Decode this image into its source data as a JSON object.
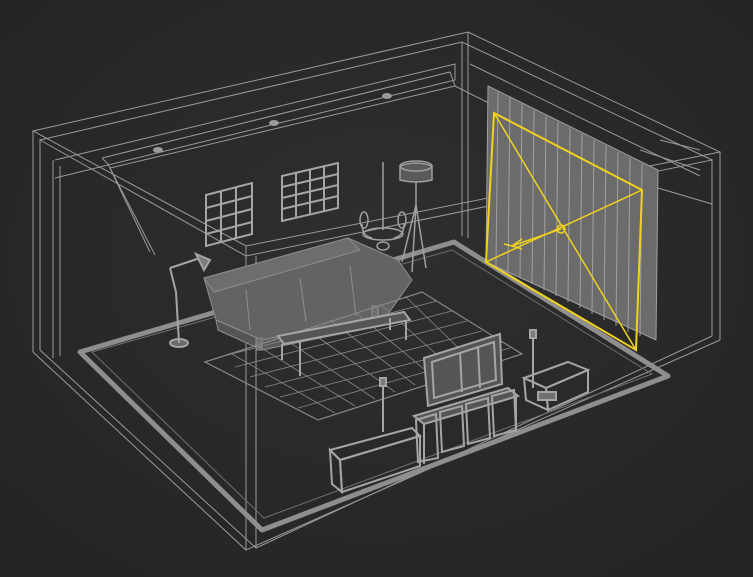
{
  "viewport": {
    "view": "perspective",
    "render_mode": "wireframe",
    "background_color": "#2a2a2a",
    "wire_color": "#8c8c8c",
    "selection_color": "#f0d21e"
  },
  "scene": {
    "objects": [
      "room-shell",
      "ceiling-cove",
      "ceiling-spotlights",
      "window-left",
      "window-right",
      "chandelier",
      "floor-lamp-tripod",
      "floor-lamp-arc",
      "sofa",
      "coffee-table",
      "rug",
      "tv-stand",
      "tv",
      "floor-speakers",
      "side-cabinet",
      "curtain",
      "target-light"
    ],
    "selected_object": "target-light"
  }
}
